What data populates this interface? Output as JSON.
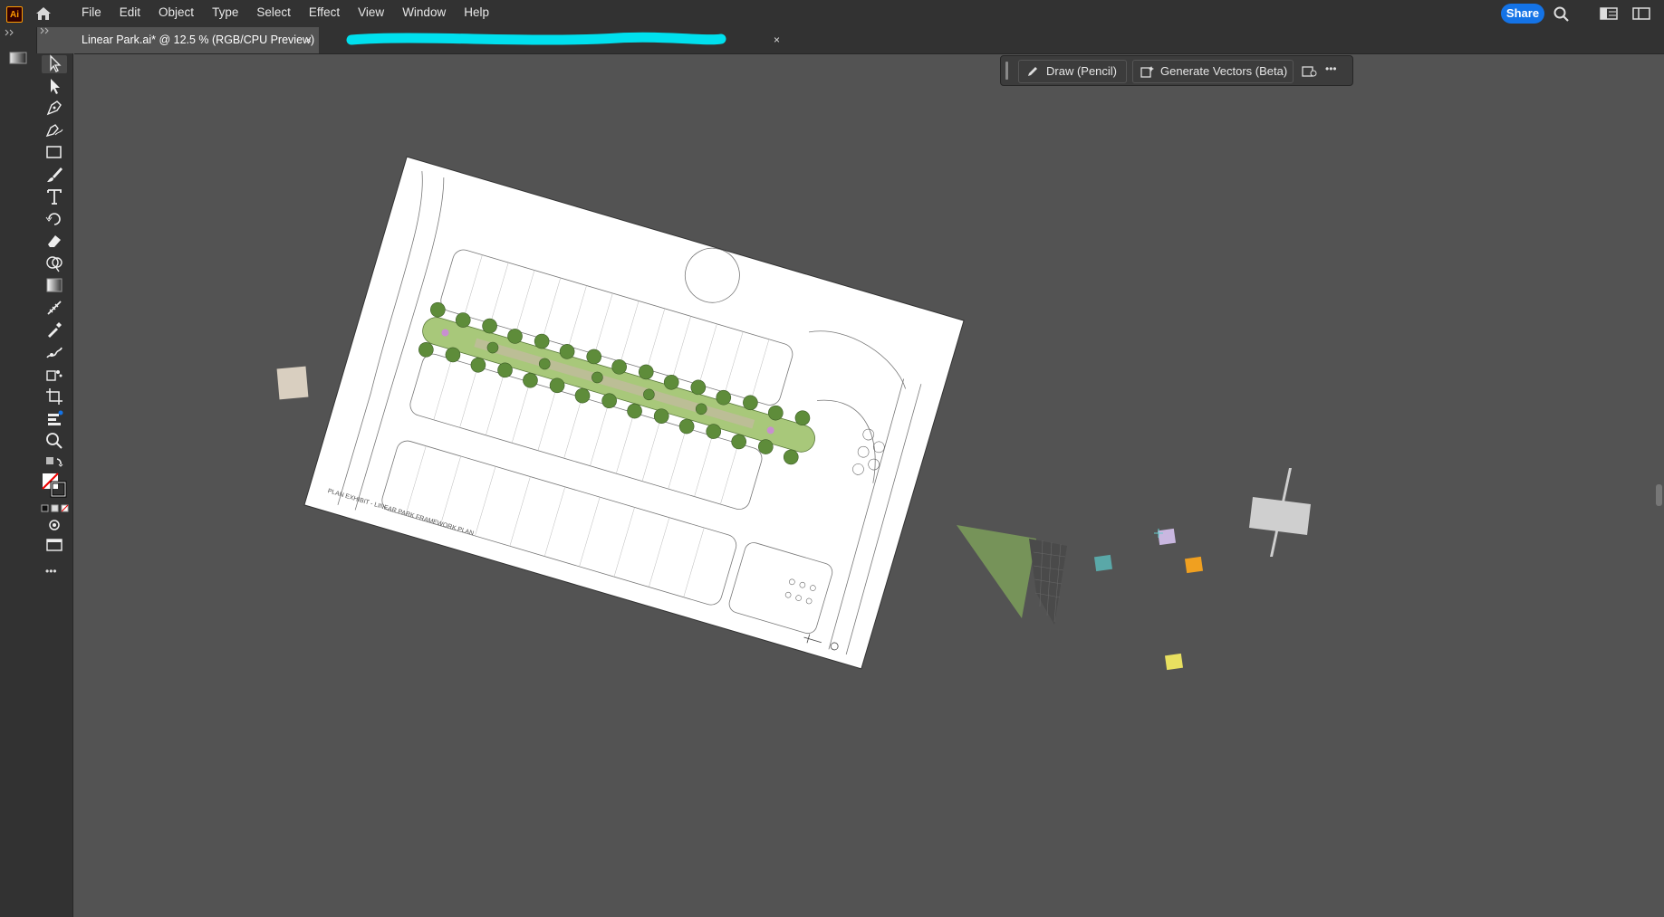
{
  "app": {
    "logo": "Ai"
  },
  "menu": [
    "File",
    "Edit",
    "Object",
    "Type",
    "Select",
    "Effect",
    "View",
    "Window",
    "Help"
  ],
  "header": {
    "share_label": "Share"
  },
  "tabs": [
    {
      "label": "Linear Park.ai* @ 12.5 % (RGB/CPU Preview)",
      "close": "×"
    },
    {
      "label": "",
      "close": "×"
    }
  ],
  "context_bar": {
    "draw_label": "Draw (Pencil)",
    "generate_label": "Generate Vectors (Beta)",
    "more": "•••"
  },
  "toolbar": {
    "more": "•••"
  },
  "artboard": {
    "caption": "PLAN EXHIBIT - LINEAR PARK FRAMEWORK PLAN"
  },
  "colors": {
    "accent": "#1473e6",
    "canvas": "#535353",
    "chrome": "#323232",
    "swatch_tan": "#d9cfc0",
    "swatch_teal": "#5aa8a8",
    "swatch_lilac": "#c9b7e0",
    "swatch_orange": "#f0a020",
    "swatch_yellow": "#e8e060",
    "tree_green": "#5e8c3a"
  }
}
